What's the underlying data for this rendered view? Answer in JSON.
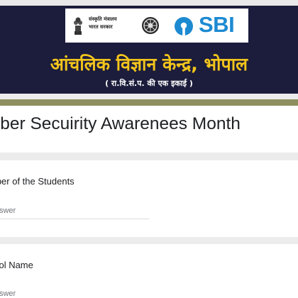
{
  "banner": {
    "ministry_line1": "संस्कृति मंत्रालय",
    "ministry_line2": "भारत सरकार",
    "sbi_text": "SBI",
    "hindi_title": "आंचलिक विज्ञान केन्द्र, भोपाल",
    "hindi_subtitle": "( रा.वि.सं.प. की एक इकाई )",
    "icons": [
      "national-emblem-icon",
      "ncsm-wheel-logo-icon",
      "sbi-logo-icon"
    ],
    "colors": {
      "background": "#1c1c3c",
      "title": "#f3c51c",
      "sbi_blue": "#1c8ad1"
    }
  },
  "form": {
    "title": "yber Secuirity Awarenees Month",
    "accent_color": "#8d8f5e",
    "questions": [
      {
        "label": "mber of the Students",
        "placeholder": "r answer"
      },
      {
        "label": "hool Name",
        "placeholder": "r answer"
      }
    ]
  }
}
